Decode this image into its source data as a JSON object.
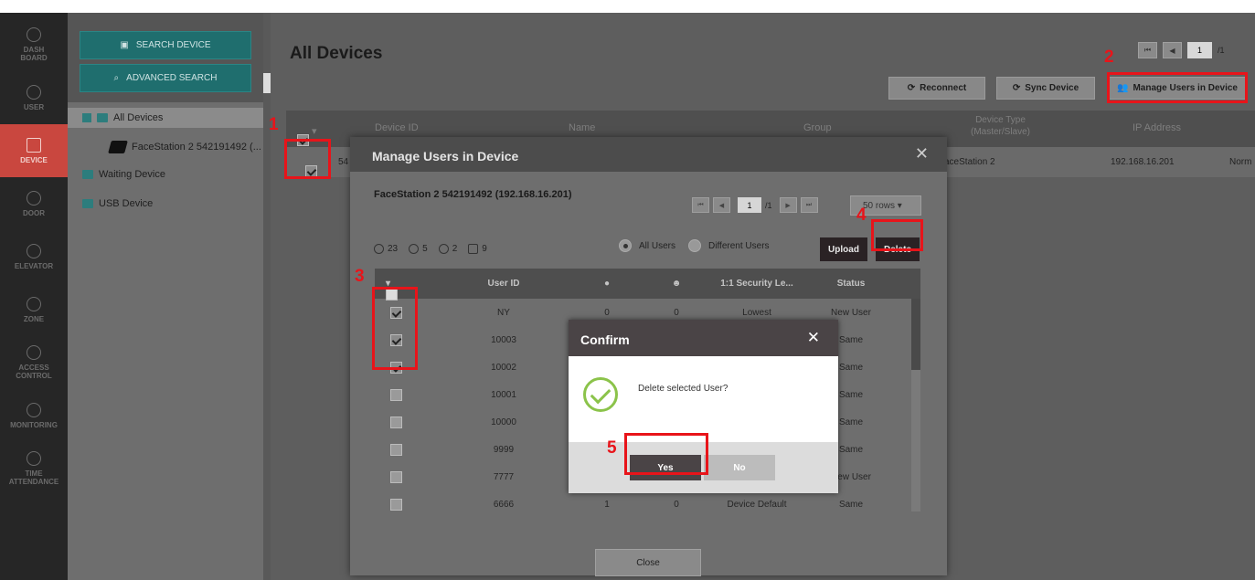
{
  "nav": [
    {
      "label": "DASH\nBOARD",
      "icon": "dashboard-icon"
    },
    {
      "label": "USER",
      "icon": "user-icon"
    },
    {
      "label": "DEVICE",
      "icon": "device-icon",
      "active": true
    },
    {
      "label": "DOOR",
      "icon": "door-icon"
    },
    {
      "label": "ELEVATOR",
      "icon": "elevator-icon"
    },
    {
      "label": "ZONE",
      "icon": "zone-icon"
    },
    {
      "label": "ACCESS\nCONTROL",
      "icon": "access-control-icon"
    },
    {
      "label": "MONITORING",
      "icon": "monitoring-icon"
    },
    {
      "label": "TIME\nATTENDANCE",
      "icon": "time-attendance-icon"
    }
  ],
  "tree": {
    "search_device": "SEARCH DEVICE",
    "advanced_search": "ADVANCED SEARCH",
    "all_devices": "All Devices",
    "device_item": "FaceStation 2 542191492 (...",
    "waiting_device": "Waiting Device",
    "usb_device": "USB Device"
  },
  "main": {
    "title": "All Devices",
    "pager": {
      "page": "1",
      "total": "/1"
    },
    "buttons": {
      "reconnect": "Reconnect",
      "sync": "Sync Device",
      "manage": "Manage Users in Device"
    },
    "columns": {
      "device_id": "Device ID",
      "name": "Name",
      "group": "Group",
      "device_type": "Device Type\n(Master/Slave)",
      "ip": "IP Address"
    },
    "row": {
      "id_prefix": "54",
      "type": "aceStation 2",
      "ip": "192.168.16.201",
      "status": "Norm"
    }
  },
  "modal": {
    "title": "Manage Users in Device",
    "device": "FaceStation 2 542191492 (192.168.16.201)",
    "pager": {
      "page": "1",
      "total": "/1"
    },
    "rows_select": "50 rows",
    "stats": {
      "users": "23",
      "fingerprints": "5",
      "faces": "2",
      "cards": "9"
    },
    "filter": {
      "all_users": "All Users",
      "different_users": "Different Users"
    },
    "upload": "Upload",
    "delete": "Delete",
    "headers": {
      "user_id": "User ID",
      "security": "1:1 Security Le...",
      "status": "Status"
    },
    "users": [
      {
        "id": "NY",
        "fp": "0",
        "face": "0",
        "security": "Lowest",
        "status": "New User",
        "checked": true
      },
      {
        "id": "10003",
        "fp": "",
        "face": "",
        "security": "",
        "status": "Same",
        "checked": true
      },
      {
        "id": "10002",
        "fp": "",
        "face": "",
        "security": "",
        "status": "Same",
        "checked": true
      },
      {
        "id": "10001",
        "fp": "",
        "face": "",
        "security": "",
        "status": "Same",
        "checked": false
      },
      {
        "id": "10000",
        "fp": "",
        "face": "",
        "security": "",
        "status": "Same",
        "checked": false
      },
      {
        "id": "9999",
        "fp": "",
        "face": "",
        "security": "",
        "status": "Same",
        "checked": false
      },
      {
        "id": "7777",
        "fp": "",
        "face": "",
        "security": "",
        "status": "New User",
        "checked": false
      },
      {
        "id": "6666",
        "fp": "1",
        "face": "0",
        "security": "Device Default",
        "status": "Same",
        "checked": false
      }
    ],
    "close": "Close"
  },
  "confirm": {
    "title": "Confirm",
    "message": "Delete selected User?",
    "yes": "Yes",
    "no": "No"
  },
  "annotations": [
    "1",
    "2",
    "3",
    "4",
    "5"
  ],
  "colors": {
    "annotation": "#e8141a",
    "active_nav": "#c9473f",
    "teal": "#1f6e6e"
  }
}
